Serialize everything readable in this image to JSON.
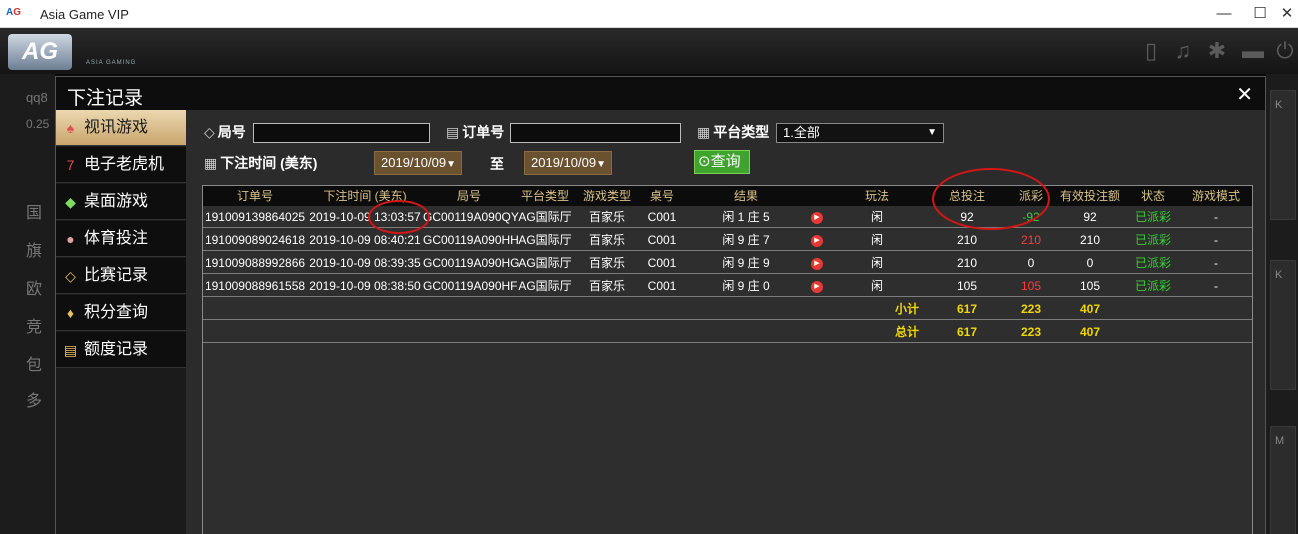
{
  "window": {
    "title": "Asia Game VIP",
    "logo": "AG",
    "minimize": "—",
    "maximize": "☐",
    "close": "✕"
  },
  "header": {
    "logo": "AG",
    "logo_sub": "ASIA GAMING",
    "icons": [
      "phone-icon",
      "music-icon",
      "gear-icon",
      "chat-icon",
      "power-icon"
    ]
  },
  "background": {
    "user": "qq8",
    "balance": "0.25",
    "left_rows": [
      "国",
      "旗",
      "欧",
      "竞",
      "包",
      "多"
    ],
    "right_tiles": [
      "K",
      "K",
      "M"
    ]
  },
  "modal": {
    "title": "下注记录",
    "close": "✕",
    "sidebar": [
      {
        "label": "视讯游戏",
        "icon": "cards-icon"
      },
      {
        "label": "电子老虎机",
        "icon": "slot-icon"
      },
      {
        "label": "桌面游戏",
        "icon": "dice-icon"
      },
      {
        "label": "体育投注",
        "icon": "ball-icon"
      },
      {
        "label": "比赛记录",
        "icon": "tag-icon"
      },
      {
        "label": "积分查询",
        "icon": "diamond-icon"
      },
      {
        "label": "额度记录",
        "icon": "document-icon"
      }
    ],
    "active_index": 0,
    "filters": {
      "round_label": "局号",
      "order_label": "订单号",
      "platform_label": "平台类型",
      "platform_value": "1.全部",
      "time_label": "下注时间 (美东)",
      "date_from": "2019/10/09",
      "to_label": "至",
      "date_to": "2019/10/09",
      "query_label": "查询"
    },
    "table": {
      "headers": [
        "订单号",
        "下注时间 (美东)",
        "局号",
        "平台类型",
        "游戏类型",
        "桌号",
        "结果",
        "",
        "玩法",
        "总投注",
        "派彩",
        "有效投注额",
        "状态",
        "游戏模式"
      ],
      "rows": [
        [
          "191009139864025",
          "2019-10-09 13:03:57",
          "GC00119A090QY",
          "AG国际厅",
          "百家乐",
          "C001",
          "闲 1 庄 5",
          "▶",
          "闲",
          "92",
          "-92",
          "92",
          "已派彩",
          "-"
        ],
        [
          "191009089024618",
          "2019-10-09 08:40:21",
          "GC00119A090HH",
          "AG国际厅",
          "百家乐",
          "C001",
          "闲 9 庄 7",
          "▶",
          "闲",
          "210",
          "210",
          "210",
          "已派彩",
          "-"
        ],
        [
          "191009088992866",
          "2019-10-09 08:39:35",
          "GC00119A090HG",
          "AG国际厅",
          "百家乐",
          "C001",
          "闲 9 庄 9",
          "▶",
          "闲",
          "210",
          "0",
          "0",
          "已派彩",
          "-"
        ],
        [
          "191009088961558",
          "2019-10-09 08:38:50",
          "GC00119A090HF",
          "AG国际厅",
          "百家乐",
          "C001",
          "闲 9 庄 0",
          "▶",
          "闲",
          "105",
          "105",
          "105",
          "已派彩",
          "-"
        ]
      ],
      "subtotal": {
        "label": "小计",
        "total_bet": "617",
        "payout": "223",
        "valid_bet": "407"
      },
      "total": {
        "label": "总计",
        "total_bet": "617",
        "payout": "223",
        "valid_bet": "407"
      }
    }
  },
  "colors": {
    "accent_gold": "#c9a56d",
    "query_green": "#3ea42c",
    "sum_yellow": "#f0d800",
    "status_green": "#35d232",
    "payout_red": "#ff3a3a",
    "annotation_red": "#d41616"
  }
}
